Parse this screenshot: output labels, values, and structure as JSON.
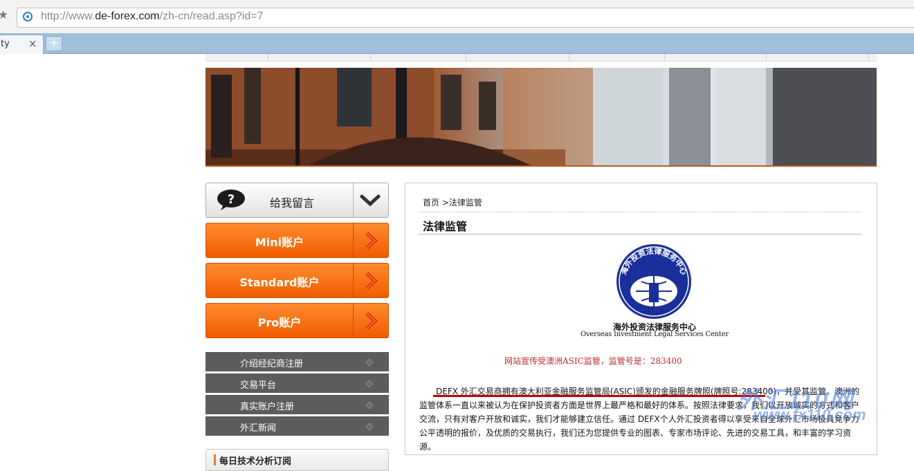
{
  "browser": {
    "url_prefix": "http://www.",
    "url_domain": "de-forex.com",
    "url_path": "/zh-cn/read.asp?id=7",
    "tab_title": "ty",
    "tab_close": "×",
    "new_tab": "+"
  },
  "sidebar": {
    "message_button": "给我留言",
    "accounts": [
      {
        "label": "Mini账户"
      },
      {
        "label": "Standard账户"
      },
      {
        "label": "Pro账户"
      }
    ],
    "menu": [
      {
        "label": "介绍经纪商注册"
      },
      {
        "label": "交易平台"
      },
      {
        "label": "真实账户注册"
      },
      {
        "label": "外汇新闻"
      }
    ],
    "daily_title": "每日技术分析订阅"
  },
  "content": {
    "breadcrumb": "首页 >法律监管",
    "title": "法律监管",
    "logo": {
      "cn": "海外投资法律服务中心",
      "en": "Overseas Investment Legal Services Center",
      "ring_text": "海外投资法律服务中心"
    },
    "asic_notice": "网站宣传受澳洲ASIC监管，监管号是：283400",
    "paragraph": "DEFX 外汇交易商拥有澳大利亚金融服务监管局(ASIC)颁发的金融服务牌照(牌照号:283400)，并受其监管。澳洲的监管体系一直以来被认为在保护投资者方面是世界上最严格和最好的体系。按照法律要求，我们以开放诚实的方式和客户交流，只有对客户开放和诚实，我们才能够建立信任。通过 DEFX个人外汇投资者得以享受来自全球外汇市场极具竞争力公平透明的报价，及优质的交易执行，我们还为您提供专业的图表、专家市场评论、先进的交易工具，和丰富的学习资源。"
  },
  "watermark": {
    "line1": "外汇110网",
    "line2": "www.fx110.com"
  },
  "colors": {
    "orange": "#f26a0f",
    "menu_gray": "#5c5c5c",
    "seal_blue": "#1a2f9a",
    "notice_red": "#c0282a"
  }
}
